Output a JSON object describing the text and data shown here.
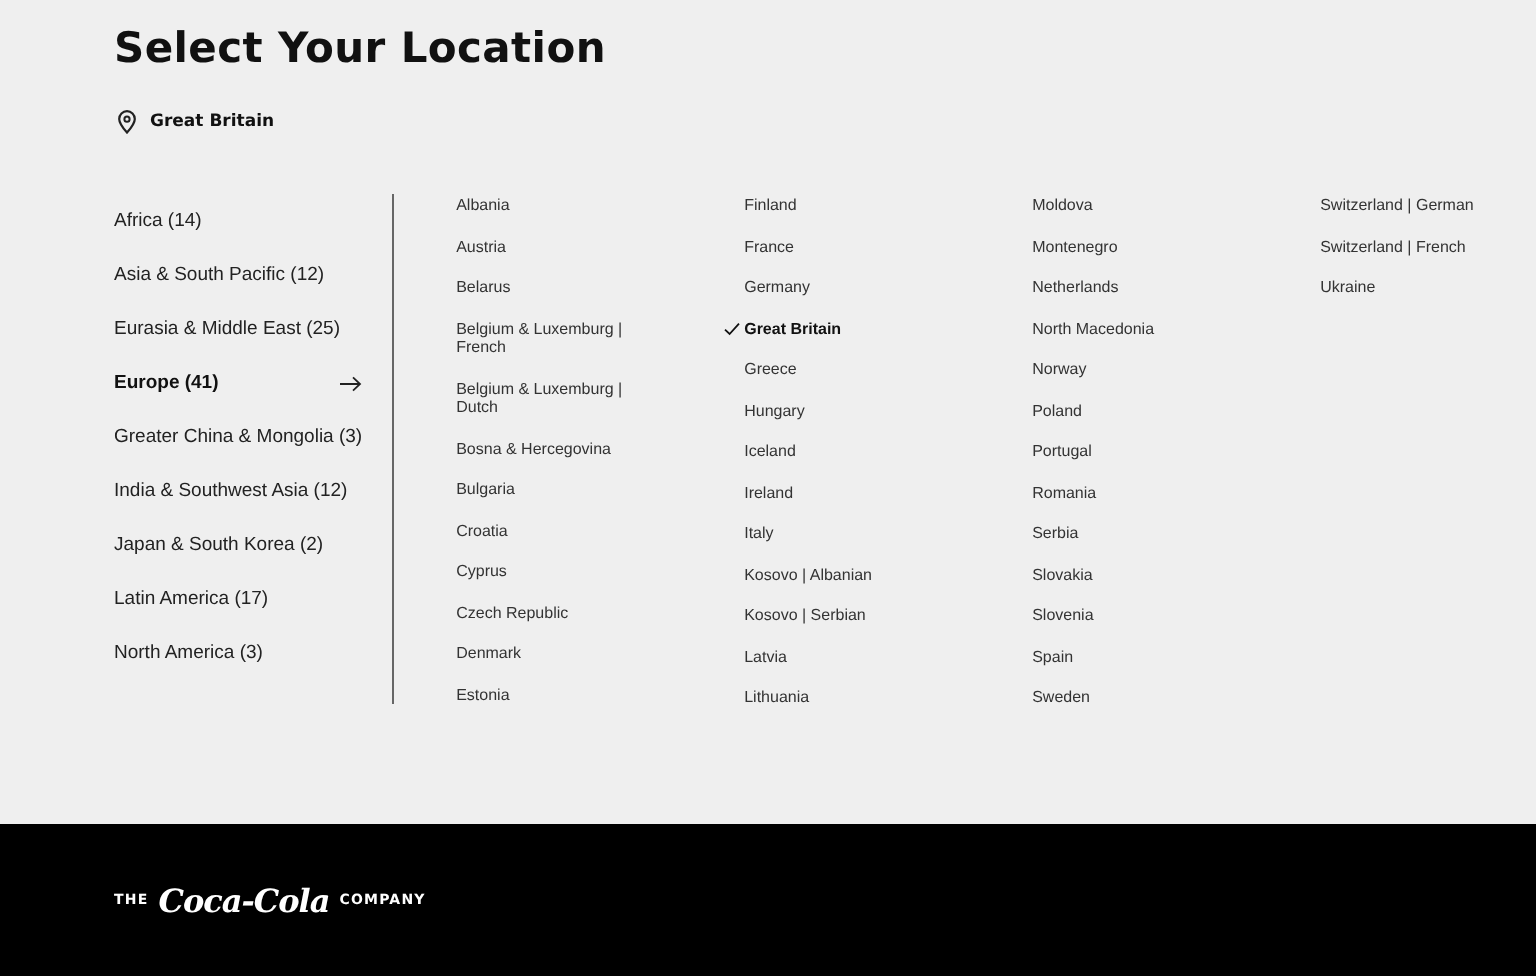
{
  "title": "Select Your Location",
  "current_location": "Great Britain",
  "regions": [
    {
      "label": "Africa (14)",
      "selected": false
    },
    {
      "label": "Asia & South Pacific (12)",
      "selected": false
    },
    {
      "label": "Eurasia & Middle East (25)",
      "selected": false
    },
    {
      "label": "Europe (41)",
      "selected": true
    },
    {
      "label": "Greater China & Mongolia (3)",
      "selected": false
    },
    {
      "label": "India & Southwest Asia (12)",
      "selected": false
    },
    {
      "label": "Japan & South Korea (2)",
      "selected": false
    },
    {
      "label": "Latin America (17)",
      "selected": false
    },
    {
      "label": "North America (3)",
      "selected": false
    }
  ],
  "country_columns": [
    [
      {
        "label": "Albania",
        "selected": false
      },
      {
        "label": "Austria",
        "selected": false
      },
      {
        "label": "Belarus",
        "selected": false
      },
      {
        "label": "Belgium & Luxemburg | French",
        "selected": false
      },
      {
        "label": "Belgium & Luxemburg | Dutch",
        "selected": false
      },
      {
        "label": "Bosna & Hercegovina",
        "selected": false
      },
      {
        "label": "Bulgaria",
        "selected": false
      },
      {
        "label": "Croatia",
        "selected": false
      },
      {
        "label": "Cyprus",
        "selected": false
      },
      {
        "label": "Czech Republic",
        "selected": false
      },
      {
        "label": "Denmark",
        "selected": false
      },
      {
        "label": "Estonia",
        "selected": false
      }
    ],
    [
      {
        "label": "Finland",
        "selected": false
      },
      {
        "label": "France",
        "selected": false
      },
      {
        "label": "Germany",
        "selected": false
      },
      {
        "label": "Great Britain",
        "selected": true
      },
      {
        "label": "Greece",
        "selected": false
      },
      {
        "label": "Hungary",
        "selected": false
      },
      {
        "label": "Iceland",
        "selected": false
      },
      {
        "label": "Ireland",
        "selected": false
      },
      {
        "label": "Italy",
        "selected": false
      },
      {
        "label": "Kosovo | Albanian",
        "selected": false
      },
      {
        "label": "Kosovo | Serbian",
        "selected": false
      },
      {
        "label": "Latvia",
        "selected": false
      },
      {
        "label": "Lithuania",
        "selected": false
      }
    ],
    [
      {
        "label": "Moldova",
        "selected": false
      },
      {
        "label": "Montenegro",
        "selected": false
      },
      {
        "label": "Netherlands",
        "selected": false
      },
      {
        "label": "North Macedonia",
        "selected": false
      },
      {
        "label": "Norway",
        "selected": false
      },
      {
        "label": "Poland",
        "selected": false
      },
      {
        "label": "Portugal",
        "selected": false
      },
      {
        "label": "Romania",
        "selected": false
      },
      {
        "label": "Serbia",
        "selected": false
      },
      {
        "label": "Slovakia",
        "selected": false
      },
      {
        "label": "Slovenia",
        "selected": false
      },
      {
        "label": "Spain",
        "selected": false
      },
      {
        "label": "Sweden",
        "selected": false
      }
    ],
    [
      {
        "label": "Switzerland | German",
        "selected": false
      },
      {
        "label": "Switzerland | French",
        "selected": false
      },
      {
        "label": "Ukraine",
        "selected": false
      }
    ]
  ],
  "footer": {
    "logo_prefix": "THE",
    "logo_name": "Coca-Cola",
    "logo_suffix": "COMPANY"
  }
}
